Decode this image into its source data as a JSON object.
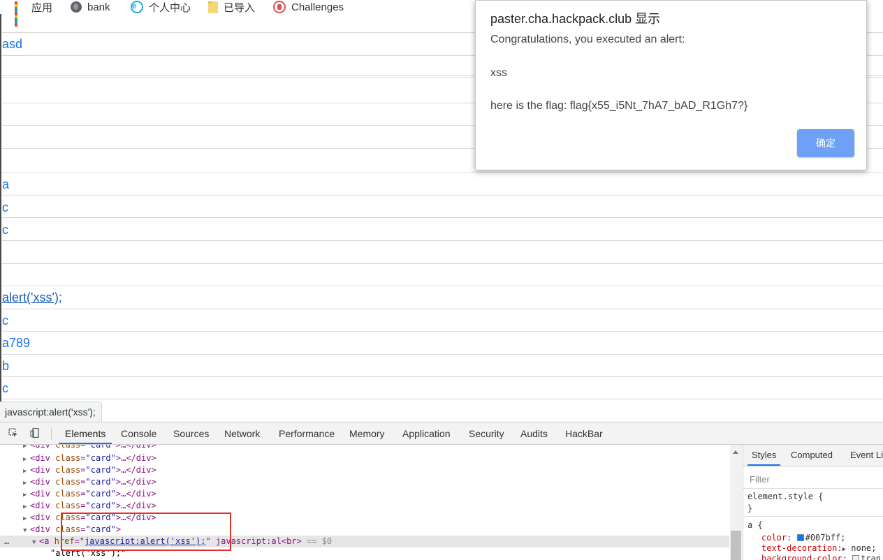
{
  "bookmarks": [
    {
      "label": "应用",
      "icon": "apps-grid-icon"
    },
    {
      "label": "bank",
      "icon": "globe-icon"
    },
    {
      "label": "个人中心",
      "icon": "ie-icon"
    },
    {
      "label": "已导入",
      "icon": "folder-icon"
    },
    {
      "label": "Challenges",
      "icon": "seal-icon"
    }
  ],
  "page_links": [
    {
      "text": "asd"
    },
    {
      "text": "a"
    },
    {
      "text": "c"
    },
    {
      "text": "c"
    },
    {
      "text": "alert('xss');"
    },
    {
      "text": "c"
    },
    {
      "text": "a789"
    },
    {
      "text": "b"
    },
    {
      "text": "c"
    }
  ],
  "status_url": "javascript:alert('xss');",
  "dialog": {
    "title": "paster.cha.hackpack.club 显示",
    "line1": "Congratulations, you executed an alert:",
    "line2": "xss",
    "line3": "here is the flag: flag{x55_i5Nt_7hA7_bAD_R1Gh7?}",
    "ok_label": "确定"
  },
  "devtools": {
    "tabs": [
      "Elements",
      "Console",
      "Sources",
      "Network",
      "Performance",
      "Memory",
      "Application",
      "Security",
      "Audits",
      "HackBar"
    ],
    "active_tab": "Elements",
    "dom": {
      "div_tag": "div",
      "class_attr": "class",
      "card_value": "\"card\"",
      "collapsed_suffix": "…</div>",
      "eq": "=",
      "a_tag": "a",
      "href_attr": "href",
      "href_value": "javascript:alert('xss');",
      "inline_text": "javascript:al",
      "br_tag": "<br>",
      "dollar0": "== $0",
      "text_node": "\"alert('xss');\"",
      "row_dots": "…"
    },
    "styles_pane": {
      "tabs": [
        "Styles",
        "Computed",
        "Event Li"
      ],
      "active_tab": "Styles",
      "filter_placeholder": "Filter",
      "element_style": "element.style {",
      "close_brace": "}",
      "rule_selector": "a {",
      "color_prop": "color:",
      "color_value": "#007bff;",
      "decoration_prop": "text-decoration:",
      "decoration_value": "none;",
      "bg_prop": "background-color:",
      "bg_value": "tran"
    }
  },
  "colors": {
    "link": "#1a73e8",
    "ok_button": "#6ea1f5",
    "highlight_box": "#e0302b",
    "swatch": "#007bff"
  }
}
